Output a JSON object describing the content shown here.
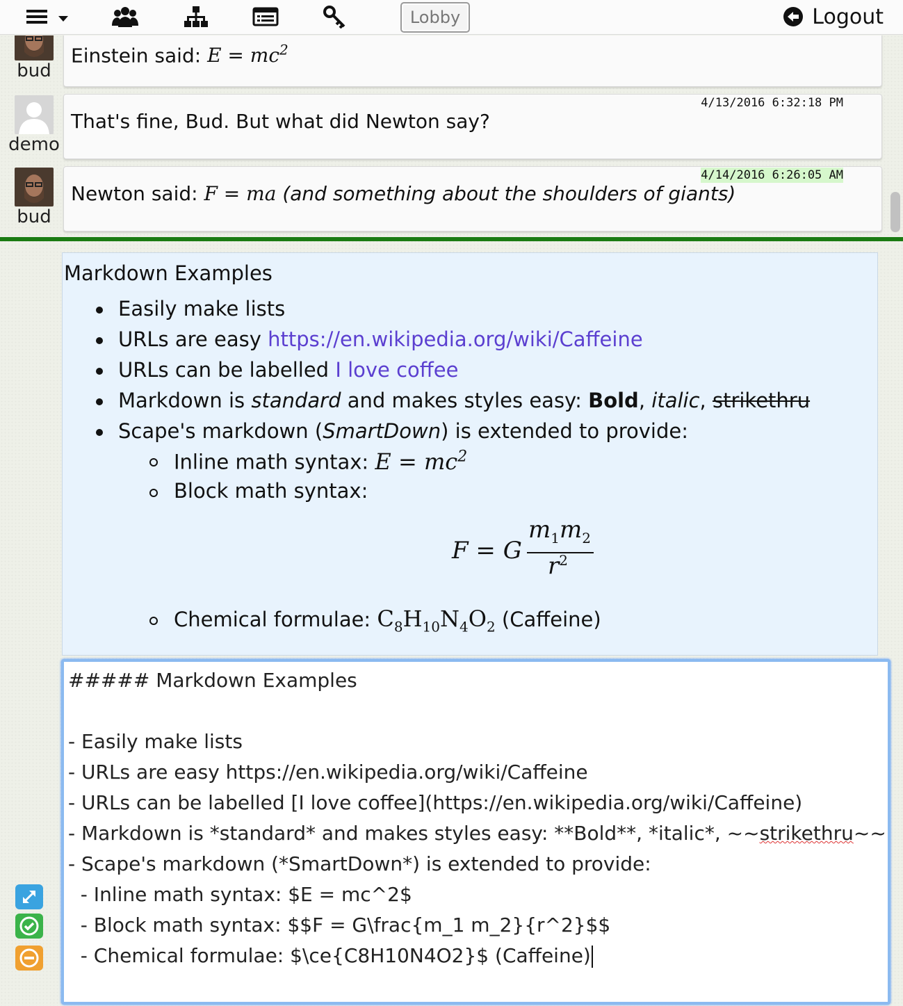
{
  "topbar": {
    "lobby_label": "Lobby",
    "logout_label": "Logout"
  },
  "messages": [
    {
      "user": "bud",
      "text_prefix": "Einstein said: ",
      "math": "E = mc2",
      "timestamp": ""
    },
    {
      "user": "demo",
      "text": "That's fine, Bud. But what did Newton say?",
      "timestamp": "4/13/2016 6:32:18 PM"
    },
    {
      "user": "bud",
      "text_prefix": "Newton said: ",
      "math": "F = ma",
      "text_suffix": " (and something about the shoulders of giants)",
      "timestamp": "4/14/2016 6:26:05 AM"
    }
  ],
  "preview": {
    "title": "Markdown Examples",
    "item1": "Easily make lists",
    "item2_prefix": "URLs are easy ",
    "item2_link": "https://en.wikipedia.org/wiki/Caffeine",
    "item3_prefix": "URLs can be labelled ",
    "item3_link": "I love coffee",
    "item4_a": "Markdown is ",
    "item4_b": "standard",
    "item4_c": " and makes styles easy: ",
    "item4_bold": "Bold",
    "item4_sep1": ", ",
    "item4_italic": "italic",
    "item4_sep2": ", ",
    "item4_strike": "strikethru",
    "item5_a": "Scape's markdown (",
    "item5_b": "SmartDown",
    "item5_c": ") is extended to provide:",
    "sub1": "Inline math syntax: ",
    "sub2": "Block math syntax:",
    "sub3_prefix": "Chemical formulae: ",
    "sub3_suffix": " (Caffeine)"
  },
  "editor": {
    "lines": [
      "##### Markdown Examples",
      "",
      "- Easily make lists",
      "- URLs are easy https://en.wikipedia.org/wiki/Caffeine",
      "- URLs can be labelled [I love coffee](https://en.wikipedia.org/wiki/Caffeine)",
      "- Markdown is *standard* and makes styles easy: **Bold**, *italic*, ~~",
      "- Scape's markdown (*SmartDown*) is extended to provide:",
      "  - Inline math syntax: $E = mc^2$",
      "  - Block math syntax: $$F = G\\frac{m_1 m_2}{r^2}$$",
      "  - Chemical formulae: $\\ce{C8H10N4O2}$ (Caffeine)"
    ],
    "line6_misspelled": "strikethru",
    "line6_tail": "~~"
  },
  "colors": {
    "divider": "#1a7b12",
    "link": "#5b3fd0",
    "preview_bg": "#e8f3fd",
    "editor_border": "#8bbaf0",
    "timestamp_highlight": "#d6f7cc",
    "expand_button": "#3aa3e0",
    "check_button": "#3bb34a",
    "cancel_button": "#f0a030"
  },
  "icons": [
    "menu-icon",
    "users-icon",
    "sitemap-icon",
    "list-icon",
    "key-icon",
    "logout-arrow-icon",
    "expand-icon",
    "check-icon",
    "minus-icon"
  ]
}
